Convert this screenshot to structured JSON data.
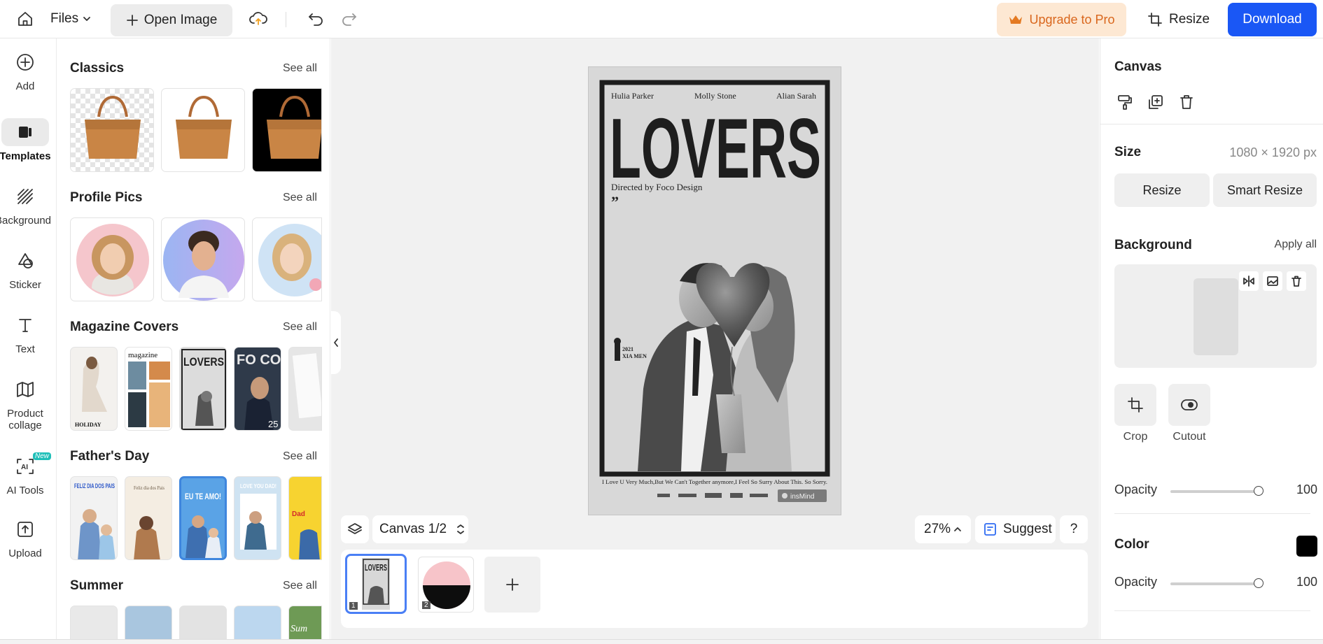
{
  "topbar": {
    "files_label": "Files",
    "open_image_label": "Open Image",
    "upgrade_label": "Upgrade to Pro",
    "resize_label": "Resize",
    "download_label": "Download"
  },
  "rail": {
    "items": [
      {
        "label": "Add"
      },
      {
        "label": "Templates"
      },
      {
        "label": "Background"
      },
      {
        "label": "Sticker"
      },
      {
        "label": "Text"
      },
      {
        "label": "Product collage"
      },
      {
        "label": "AI Tools",
        "badge": "New"
      },
      {
        "label": "Upload"
      }
    ]
  },
  "templates": {
    "see_all": "See all",
    "sections": [
      {
        "title": "Classics"
      },
      {
        "title": "Profile Pics"
      },
      {
        "title": "Magazine Covers"
      },
      {
        "title": "Father's Day"
      },
      {
        "title": "Summer"
      }
    ],
    "thumb_text": {
      "magazine": "magazine",
      "holiday": "HOLIDAY",
      "lovers": "LOVERS",
      "foco": "FO CO",
      "issue": "25",
      "feliz": "FELIZ DIA DOS PAIS",
      "feliz2": "Feliz dia dos Pais",
      "eute": "EU TE AMO!",
      "loveyoudad": "LOVE YOU DAD!",
      "dad": "Dad",
      "summer": "Sum"
    }
  },
  "poster": {
    "name1": "Hulia Parker",
    "name2": "Molly Stone",
    "name3": "Alian Sarah",
    "title": "LOVERS",
    "director": "Directed by Foco Design",
    "quote": "”",
    "year": "2021",
    "place": "XIA MEN",
    "tagline": "I Love U Very Much,But We Can't Together anymore,I Feel So Surry About This. So Sorry.",
    "brand": "insMind"
  },
  "canvas_bar": {
    "canvas_label": "Canvas 1/2",
    "zoom": "27%",
    "suggest_label": "Suggest",
    "help": "?",
    "pages": [
      {
        "number": "1",
        "title": "LOVERS"
      },
      {
        "number": "2"
      }
    ]
  },
  "panel": {
    "canvas_title": "Canvas",
    "size_label": "Size",
    "size_value": "1080 × 1920 px",
    "resize_label": "Resize",
    "smart_resize_label": "Smart Resize",
    "background_label": "Background",
    "apply_all_label": "Apply all",
    "crop_label": "Crop",
    "cutout_label": "Cutout",
    "opacity_label": "Opacity",
    "bg_opacity": "100",
    "bg_opacity_fraction": 1.0,
    "color_label": "Color",
    "color_value": "#000000",
    "color_opacity_label": "Opacity",
    "color_opacity": "100",
    "color_opacity_fraction": 1.0
  },
  "colors": {
    "accent": "#1a57f5",
    "upgrade_bg": "#fde8d3",
    "upgrade_text": "#d9661c"
  }
}
